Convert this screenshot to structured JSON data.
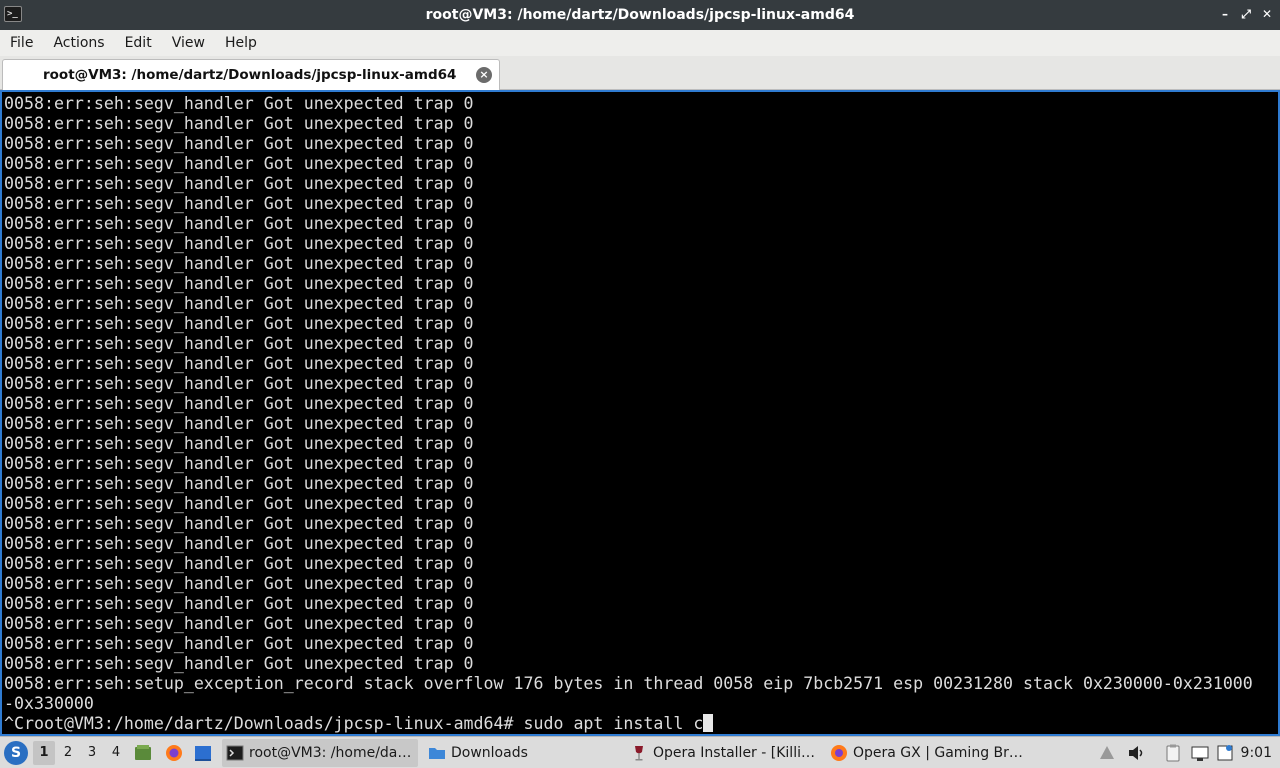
{
  "window": {
    "title": "root@VM3: /home/dartz/Downloads/jpcsp-linux-amd64",
    "icon_glyph": ">_",
    "minimize": "–",
    "maximize": "⤢",
    "close": "✕"
  },
  "menu": {
    "file": "File",
    "actions": "Actions",
    "edit": "Edit",
    "view": "View",
    "help": "Help"
  },
  "tab": {
    "label": "root@VM3: /home/dartz/Downloads/jpcsp-linux-amd64",
    "close": "×"
  },
  "terminal": {
    "lines": [
      "0058:err:seh:segv_handler Got unexpected trap 0",
      "0058:err:seh:segv_handler Got unexpected trap 0",
      "0058:err:seh:segv_handler Got unexpected trap 0",
      "0058:err:seh:segv_handler Got unexpected trap 0",
      "0058:err:seh:segv_handler Got unexpected trap 0",
      "0058:err:seh:segv_handler Got unexpected trap 0",
      "0058:err:seh:segv_handler Got unexpected trap 0",
      "0058:err:seh:segv_handler Got unexpected trap 0",
      "0058:err:seh:segv_handler Got unexpected trap 0",
      "0058:err:seh:segv_handler Got unexpected trap 0",
      "0058:err:seh:segv_handler Got unexpected trap 0",
      "0058:err:seh:segv_handler Got unexpected trap 0",
      "0058:err:seh:segv_handler Got unexpected trap 0",
      "0058:err:seh:segv_handler Got unexpected trap 0",
      "0058:err:seh:segv_handler Got unexpected trap 0",
      "0058:err:seh:segv_handler Got unexpected trap 0",
      "0058:err:seh:segv_handler Got unexpected trap 0",
      "0058:err:seh:segv_handler Got unexpected trap 0",
      "0058:err:seh:segv_handler Got unexpected trap 0",
      "0058:err:seh:segv_handler Got unexpected trap 0",
      "0058:err:seh:segv_handler Got unexpected trap 0",
      "0058:err:seh:segv_handler Got unexpected trap 0",
      "0058:err:seh:segv_handler Got unexpected trap 0",
      "0058:err:seh:segv_handler Got unexpected trap 0",
      "0058:err:seh:segv_handler Got unexpected trap 0",
      "0058:err:seh:segv_handler Got unexpected trap 0",
      "0058:err:seh:segv_handler Got unexpected trap 0",
      "0058:err:seh:segv_handler Got unexpected trap 0",
      "0058:err:seh:segv_handler Got unexpected trap 0",
      "0058:err:seh:setup_exception_record stack overflow 176 bytes in thread 0058 eip 7bcb2571 esp 00231280 stack 0x230000-0x231000",
      "-0x330000"
    ],
    "prompt": "^Croot@VM3:/home/dartz/Downloads/jpcsp-linux-amd64# sudo apt install c"
  },
  "taskbar": {
    "start_glyph": "S",
    "workspaces": [
      "1",
      "2",
      "3",
      "4"
    ],
    "tasks": [
      {
        "label": "root@VM3: /home/da…",
        "icon": "terminal-icon"
      },
      {
        "label": "Downloads",
        "icon": "folder-icon"
      },
      {
        "label": "Opera Installer - [Killi…",
        "icon": "wine-glass-icon"
      },
      {
        "label": "Opera GX | Gaming Br…",
        "icon": "firefox-icon"
      }
    ],
    "clock": "9:01"
  },
  "colors": {
    "titlebar": "#353b3f",
    "terminal_bg": "#000000",
    "terminal_fg": "#dcdcdc",
    "accent": "#2f7bd1",
    "taskbar": "#dcdcdc"
  }
}
